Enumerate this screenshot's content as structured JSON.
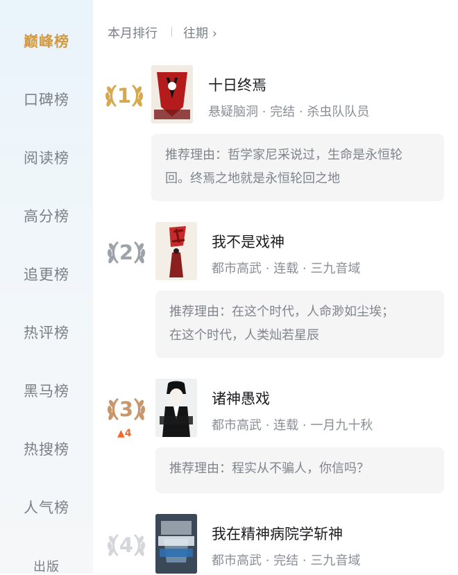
{
  "sidebar": {
    "items": [
      {
        "label": "巅峰榜"
      },
      {
        "label": "口碑榜"
      },
      {
        "label": "阅读榜"
      },
      {
        "label": "高分榜"
      },
      {
        "label": "追更榜"
      },
      {
        "label": "热评榜"
      },
      {
        "label": "黑马榜"
      },
      {
        "label": "热搜榜"
      },
      {
        "label": "人气榜"
      },
      {
        "label": "出版"
      }
    ],
    "active_index": 0
  },
  "header": {
    "current_tab": "本月排行",
    "past_tab": "往期 ›"
  },
  "books": [
    {
      "rank": "1",
      "rank_color": "#d7a94f",
      "title": "十日终焉",
      "meta": "悬疑脑洞 · 完结 · 杀虫队队员",
      "reason_line1": "推荐理由：哲学家尼采说过，生命是永恒轮",
      "reason_line2": "回。终焉之地就是永恒轮回之地",
      "trend": ""
    },
    {
      "rank": "2",
      "rank_color": "#9ea3aa",
      "title": "我不是戏神",
      "meta": "都市高武 · 连载 · 三九音域",
      "reason_line1": "推荐理由：在这个时代，人命渺如尘埃；",
      "reason_line2": "在这个时代，人类灿若星辰",
      "trend": ""
    },
    {
      "rank": "3",
      "rank_color": "#c7966a",
      "title": "诸神愚戏",
      "meta": "都市高武 · 连载 · 一月九十秋",
      "reason_line1": "推荐理由：程实从不骗人，你信吗？",
      "reason_line2": "",
      "trend": "▲4"
    },
    {
      "rank": "4",
      "rank_color": "#d4d6da",
      "title": "我在精神病院学斩神",
      "meta": "都市高武 · 完结 · 三九音域",
      "reason_line1": "",
      "reason_line2": "",
      "trend": ""
    }
  ],
  "colors": {
    "accent_gold": "#d29a41",
    "trend_orange": "#f26a2d"
  }
}
